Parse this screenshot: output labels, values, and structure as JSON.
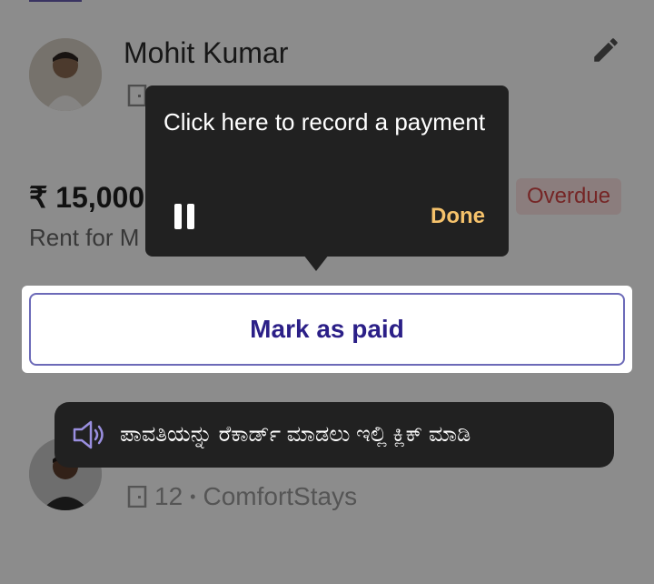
{
  "tenant_card_1": {
    "name": "Mohit Kumar",
    "rent_amount": "₹ 15,000",
    "rent_for": "Rent for M",
    "status": "Overdue"
  },
  "mark_paid": {
    "label": "Mark as paid"
  },
  "tooltip": {
    "text": "Click here to record a payment",
    "done_label": "Done"
  },
  "audio_hint": {
    "text": "ಪಾವತಿಯನ್ನು ರೆಕಾರ್ಡ್ ಮಾಡಲು ಇಲ್ಲಿ ಕ್ಲಿಕ್ ಮಾಡಿ"
  },
  "tenant_card_2": {
    "room": "12",
    "property": "ComfortStays"
  },
  "colors": {
    "accent": "#2b1f87",
    "tooltip_bg": "#212121",
    "done": "#f5c26b",
    "overdue": "#d64545"
  }
}
